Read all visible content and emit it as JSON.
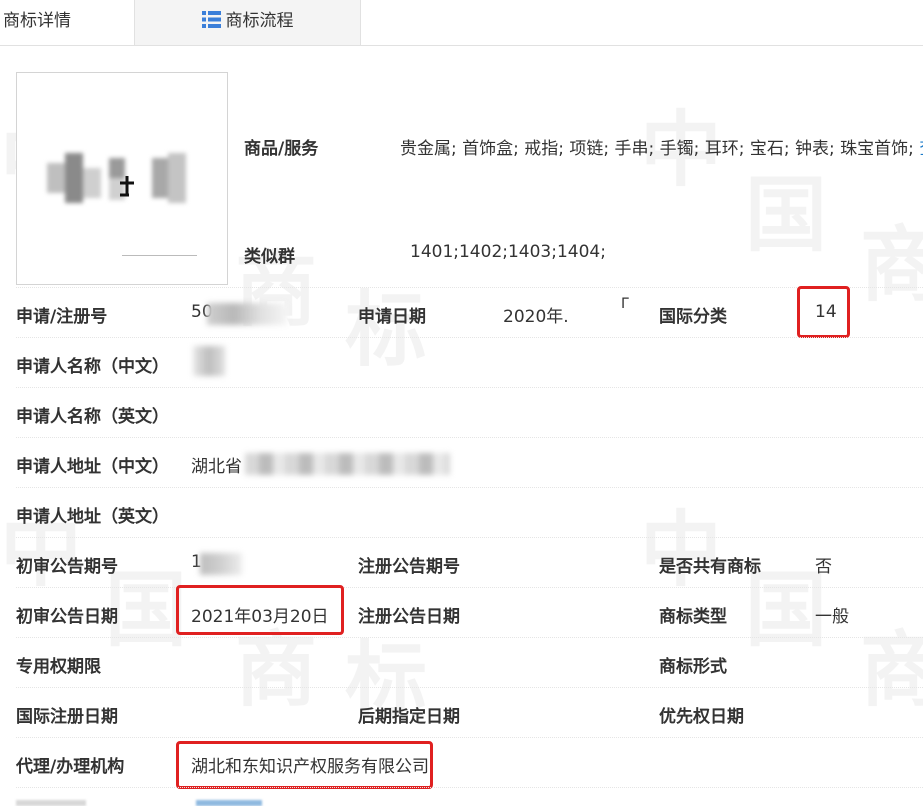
{
  "tabs": {
    "details": "商标详情",
    "process": "商标流程"
  },
  "watermark": [
    "中",
    "国",
    "商",
    "标"
  ],
  "goods": {
    "label": "商品/服务",
    "value": "贵金属; 首饰盒; 戒指; 项链; 手串; 手镯; 耳环; 宝石; 钟表; 珠宝首饰;",
    "more": "查"
  },
  "similar_group": {
    "label": "类似群",
    "value": "1401;1402;1403;1404;"
  },
  "fields": {
    "reg_no_label": "申请/注册号",
    "reg_no_value": "50",
    "app_date_label": "申请日期",
    "app_date_value": "2020年.",
    "intl_class_label": "国际分类",
    "intl_class_value": "14",
    "applicant_cn_label": "申请人名称（中文）",
    "applicant_en_label": "申请人名称（英文）",
    "address_cn_label": "申请人地址（中文）",
    "address_cn_value": "湖北省",
    "address_en_label": "申请人地址（英文）",
    "prelim_no_label": "初审公告期号",
    "prelim_no_value": "1",
    "reg_pub_no_label": "注册公告期号",
    "shared_label": "是否共有商标",
    "shared_value": "否",
    "prelim_date_label": "初审公告日期",
    "prelim_date_value": "2021年03月20日",
    "reg_pub_date_label": "注册公告日期",
    "tm_type_label": "商标类型",
    "tm_type_value": "一般",
    "exclusive_label": "专用权期限",
    "tm_form_label": "商标形式",
    "intl_reg_date_label": "国际注册日期",
    "later_date_label": "后期指定日期",
    "priority_date_label": "优先权日期",
    "agent_label": "代理/办理机构",
    "agent_value": "湖北和东知识产权服务有限公司"
  },
  "colors": {
    "highlight": "#e02020",
    "link": "#1a7ac9",
    "tab_icon": "#3b7fd9"
  }
}
